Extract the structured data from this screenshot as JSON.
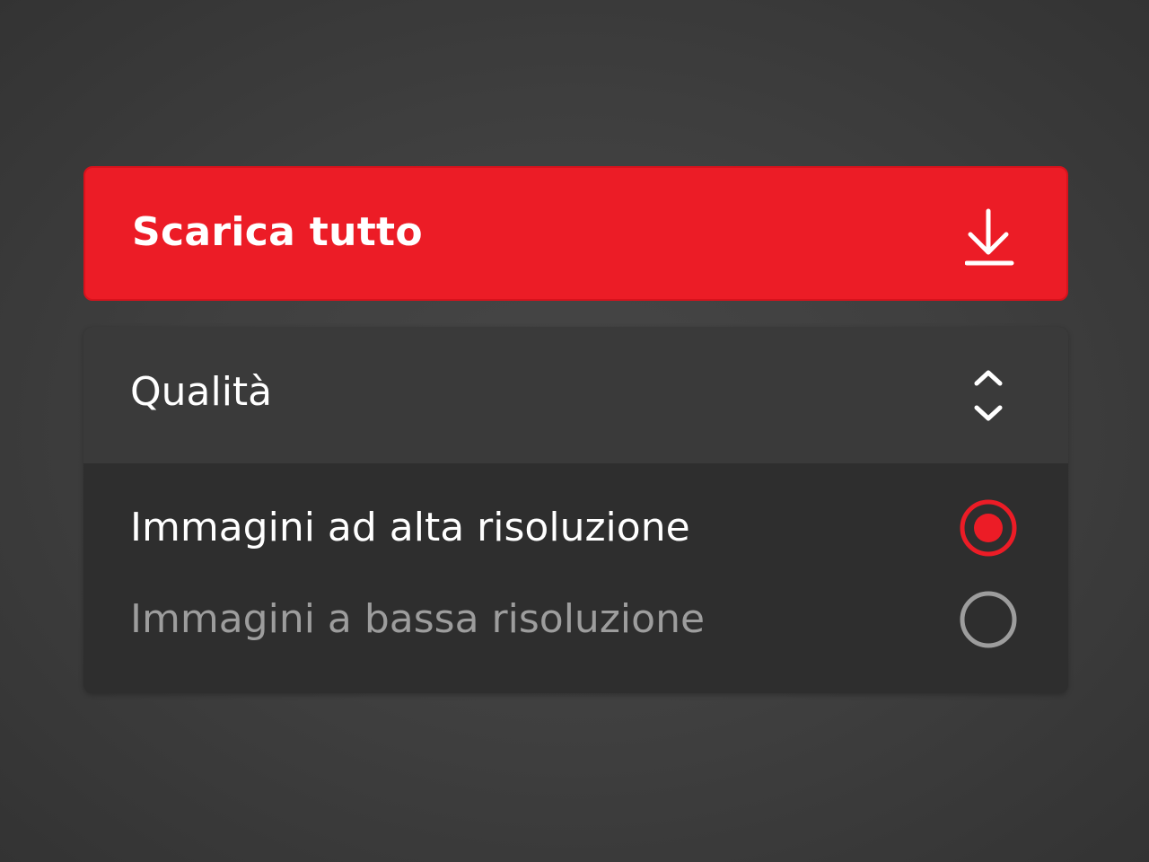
{
  "download_button": {
    "label": "Scarica tutto",
    "icon": "download-icon",
    "color": "#ec1c26"
  },
  "quality": {
    "label": "Qualità",
    "icon": "chevron-up-down-icon",
    "options": [
      {
        "label": "Immagini ad alta risoluzione",
        "selected": true
      },
      {
        "label": "Immagini a bassa risoluzione",
        "selected": false
      }
    ]
  },
  "colors": {
    "accent": "#ec1c26",
    "header_bg": "#3a3a3a",
    "options_bg": "#2e2e2e",
    "muted_text": "#9d9d9d"
  }
}
